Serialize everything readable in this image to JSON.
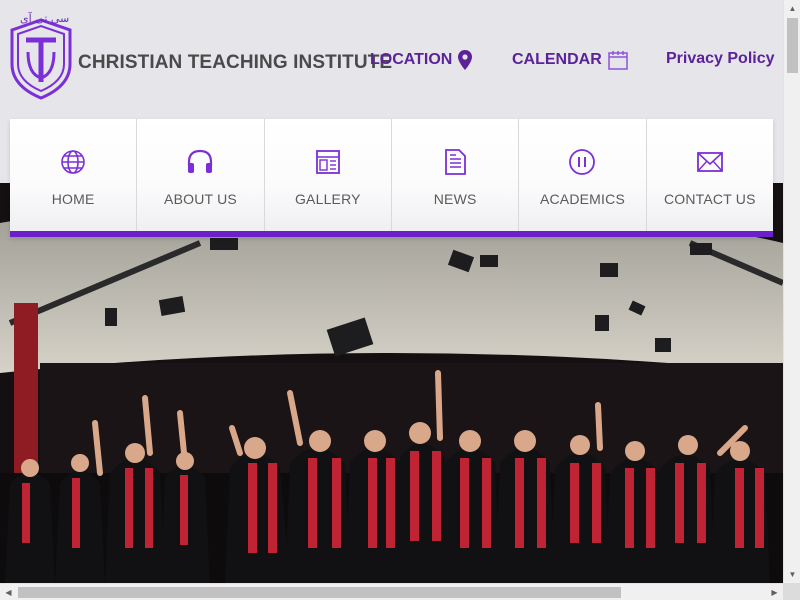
{
  "header": {
    "logo_arabic": "سى تى آى",
    "brand_name": "CHRISTIAN TEACHING INSTITUTE",
    "links": {
      "location": "LOCATION",
      "calendar": "CALENDAR",
      "privacy": "Privacy Policy"
    }
  },
  "nav": {
    "items": [
      {
        "label": "HOME",
        "icon": "globe-icon"
      },
      {
        "label": "ABOUT US",
        "icon": "headphones-icon"
      },
      {
        "label": "GALLERY",
        "icon": "gallery-icon"
      },
      {
        "label": "NEWS",
        "icon": "document-icon"
      },
      {
        "label": "ACADEMICS",
        "icon": "pause-circle-icon"
      },
      {
        "label": "CONTACT US",
        "icon": "envelope-icon"
      }
    ]
  },
  "colors": {
    "accent": "#6a1fc9",
    "brand_text": "#5b2398",
    "header_bg": "#e6e5ea"
  }
}
